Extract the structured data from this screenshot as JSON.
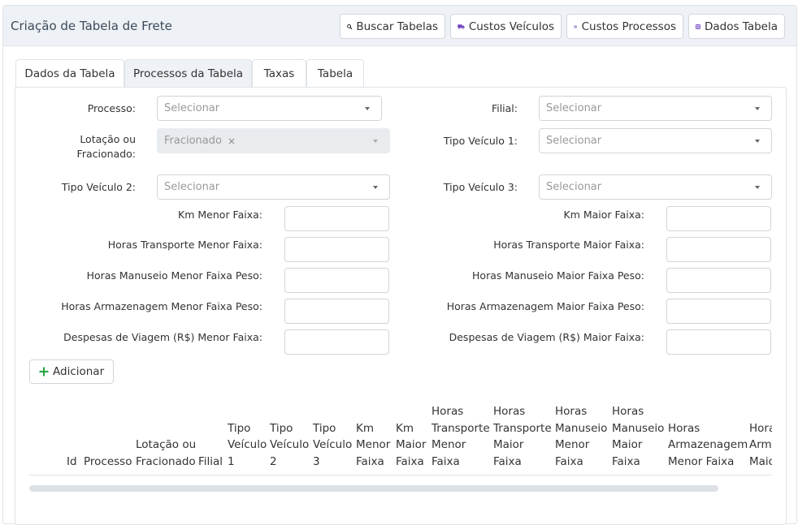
{
  "header": {
    "title": "Criação de Tabela de Frete",
    "buttons": {
      "buscar": "Buscar Tabelas",
      "veiculos": "Custos Veículos",
      "processos": "Custos Processos",
      "dados": "Dados Tabela"
    },
    "colors": {
      "truck": "#6f42c1",
      "chevrons": "#6f42c1",
      "grid": "#6f42c1",
      "search": "#111111"
    }
  },
  "tabs": [
    "Dados da Tabela",
    "Processos da Tabela",
    "Taxas",
    "Tabela"
  ],
  "active_tab": "Processos da Tabela",
  "form": {
    "processo_label": "Processo:",
    "processo_placeholder": "Selecionar",
    "filial_label": "Filial:",
    "filial_placeholder": "Selecionar",
    "lotacao_label_1": "Lotação ou",
    "lotacao_label_2": "Fracionado:",
    "lotacao_value": "Fracionado",
    "lotacao_remove": "×",
    "tipo1_label": "Tipo Veículo 1:",
    "tipo1_placeholder": "Selecionar",
    "tipo2_label": "Tipo Veículo 2:",
    "tipo2_placeholder": "Selecionar",
    "tipo3_label": "Tipo Veículo 3:",
    "tipo3_placeholder": "Selecionar",
    "km_menor_label": "Km Menor Faixa:",
    "km_maior_label": "Km Maior Faixa:",
    "horas_transp_menor_label": "Horas Transporte Menor Faixa:",
    "horas_transp_maior_label": "Horas Transporte Maior Faixa:",
    "horas_manus_menor_label": "Horas Manuseio Menor Faixa Peso:",
    "horas_manus_maior_label": "Horas Manuseio Maior Faixa Peso:",
    "horas_armaz_menor_label": "Horas Armazenagem Menor Faixa Peso:",
    "horas_armaz_maior_label": "Horas Armazenagem Maior Faixa Peso:",
    "despesas_menor_label": "Despesas de Viagem (R$) Menor Faixa:",
    "despesas_maior_label": "Despesas de Viagem (R$) Maior Faixa:",
    "add_label": "Adicionar",
    "add_color": "#28a745"
  },
  "table": {
    "columns": [
      "Id",
      "Processo",
      "Lotação ou\nFracionado",
      "Filial",
      "Tipo\nVeículo\n1",
      "Tipo\nVeículo\n2",
      "Tipo\nVeículo\n3",
      "Km\nMenor\nFaixa",
      "Km\nMaior\nFaixa",
      "Horas\nTransporte\nMenor\nFaixa",
      "Horas\nTransporte\nMaior\nFaixa",
      "Horas\nManuseio\nMenor\nFaixa",
      "Horas\nManuseio\nMaior\nFaixa",
      "Horas\nArmazenagem\nMenor Faixa",
      "Horas\nArmazenagem\nMaior Faixa"
    ]
  }
}
